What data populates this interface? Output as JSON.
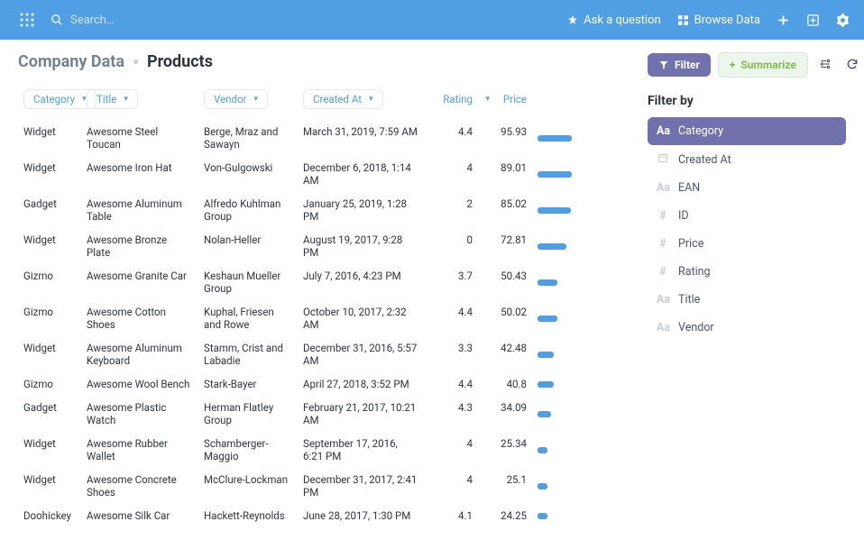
{
  "topbar": {
    "search_placeholder": "Search…",
    "ask": "Ask a question",
    "browse": "Browse Data"
  },
  "breadcrumb": {
    "parent": "Company Data",
    "current": "Products"
  },
  "toolbar": {
    "filter": "Filter",
    "summarize": "Summarize"
  },
  "columns": {
    "category": "Category",
    "title": "Title",
    "vendor": "Vendor",
    "created": "Created At",
    "rating": "Rating",
    "price": "Price"
  },
  "rows": [
    {
      "category": "Widget",
      "title": "Awesome Steel Toucan",
      "vendor": "Berge, Mraz and Sawayn",
      "created": "March 31, 2019, 7:59 AM",
      "rating": "4.4",
      "price": "95.93",
      "bar": 100
    },
    {
      "category": "Widget",
      "title": "Awesome Iron Hat",
      "vendor": "Von-Gulgowski",
      "created": "December 6, 2018, 1:14 AM",
      "rating": "4",
      "price": "89.01",
      "bar": 92
    },
    {
      "category": "Gadget",
      "title": "Awesome Aluminum Table",
      "vendor": "Alfredo Kuhlman Group",
      "created": "January 25, 2019, 1:28 PM",
      "rating": "2",
      "price": "85.02",
      "bar": 88
    },
    {
      "category": "Widget",
      "title": "Awesome Bronze Plate",
      "vendor": "Nolan-Heller",
      "created": "August 19, 2017, 9:28 PM",
      "rating": "0",
      "price": "72.81",
      "bar": 75
    },
    {
      "category": "Gizmo",
      "title": "Awesome Granite Car",
      "vendor": "Keshaun Mueller Group",
      "created": "July 7, 2016, 4:23 PM",
      "rating": "3.7",
      "price": "50.43",
      "bar": 52
    },
    {
      "category": "Gizmo",
      "title": "Awesome Cotton Shoes",
      "vendor": "Kuphal, Friesen and Rowe",
      "created": "October 10, 2017, 2:32 AM",
      "rating": "4.4",
      "price": "50.02",
      "bar": 52
    },
    {
      "category": "Widget",
      "title": "Awesome Aluminum Keyboard",
      "vendor": "Stamm, Crist and Labadie",
      "created": "December 31, 2016, 5:57 AM",
      "rating": "3.3",
      "price": "42.48",
      "bar": 44
    },
    {
      "category": "Gizmo",
      "title": "Awesome Wool Bench",
      "vendor": "Stark-Bayer",
      "created": "April 27, 2018, 3:52 PM",
      "rating": "4.4",
      "price": "40.8",
      "bar": 42
    },
    {
      "category": "Gadget",
      "title": "Awesome Plastic Watch",
      "vendor": "Herman Flatley Group",
      "created": "February 21, 2017, 10:21 AM",
      "rating": "4.3",
      "price": "34.09",
      "bar": 35
    },
    {
      "category": "Widget",
      "title": "Awesome Rubber Wallet",
      "vendor": "Schamberger-Maggio",
      "created": "September 17, 2016, 6:21 PM",
      "rating": "4",
      "price": "25.34",
      "bar": 26
    },
    {
      "category": "Widget",
      "title": "Awesome Concrete Shoes",
      "vendor": "McClure-Lockman",
      "created": "December 31, 2017, 2:41 PM",
      "rating": "4",
      "price": "25.1",
      "bar": 26
    },
    {
      "category": "Doohickey",
      "title": "Awesome Silk Car",
      "vendor": "Hackett-Reynolds",
      "created": "June 28, 2017, 1:30 PM",
      "rating": "4.1",
      "price": "24.25",
      "bar": 25
    }
  ],
  "filter": {
    "title": "Filter by",
    "items": [
      {
        "icon": "Aa",
        "label": "Category",
        "active": true
      },
      {
        "icon": "cal",
        "label": "Created At"
      },
      {
        "icon": "Aa",
        "label": "EAN"
      },
      {
        "icon": "#",
        "label": "ID"
      },
      {
        "icon": "#",
        "label": "Price"
      },
      {
        "icon": "#",
        "label": "Rating"
      },
      {
        "icon": "Aa",
        "label": "Title"
      },
      {
        "icon": "Aa",
        "label": "Vendor"
      }
    ]
  }
}
